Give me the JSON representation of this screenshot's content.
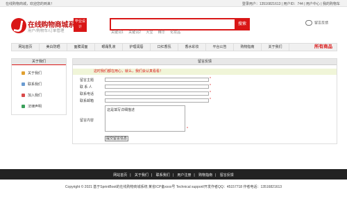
{
  "topbar": {
    "welcome": "在线购物商城，欢迎您的到来！",
    "right": "登录用户：13516821613 | 用户ID：744 | 用户中心 | 我的购物车"
  },
  "header": {
    "logo_title": "在线购物商城系统",
    "logo_sub": "用户/购物车/订单管理",
    "badge": "毕业设计",
    "search_placeholder": "",
    "search_button": "搜索",
    "hot_keywords": [
      "关键词1",
      "关键词2",
      "大宝",
      "精华",
      "化妆品"
    ],
    "feedback_link": "留言反馈"
  },
  "nav": {
    "items": [
      "网站首页",
      "美白防晒",
      "面膜润面",
      "眼霜乳液",
      "护理润唇",
      "口红香氛",
      "香水彩妆",
      "平台公告",
      "购物指南",
      "关于我们"
    ],
    "shop_label": "所有商品"
  },
  "sidebar": {
    "title": "关于我们",
    "items": [
      {
        "label": "关于我们",
        "icon": "info-icon",
        "color": "#e0a030"
      },
      {
        "label": "联系我们",
        "icon": "contact-icon",
        "color": "#6a9bd1"
      },
      {
        "label": "加入我们",
        "icon": "join-icon",
        "color": "#d94a4a"
      },
      {
        "label": "法律声明",
        "icon": "law-icon",
        "color": "#3aa05a"
      }
    ]
  },
  "main": {
    "title": "留言反馈",
    "welcome": "这时我们都在用心，就么，我们会认真看看！",
    "fields": [
      {
        "label": "留言主题",
        "value": ""
      },
      {
        "label": "联 系 人",
        "value": ""
      },
      {
        "label": "联系电话",
        "value": ""
      },
      {
        "label": "联系邮箱",
        "value": ""
      }
    ],
    "content_label": "留言内容",
    "content_placeholder": "这是填写详细描述",
    "submit": "提交留言信息"
  },
  "footer": {
    "links": [
      "网站首页",
      "关于我们",
      "联系我们",
      "用户注册",
      "购物指南",
      "留言反馈"
    ],
    "copyright": "Copyright © 2021 基于SprintBoot的在线购物商城系统   某省ICP备xxxx号   Technical support/开发作者QQ：45157718   作者电话：13516821613"
  }
}
